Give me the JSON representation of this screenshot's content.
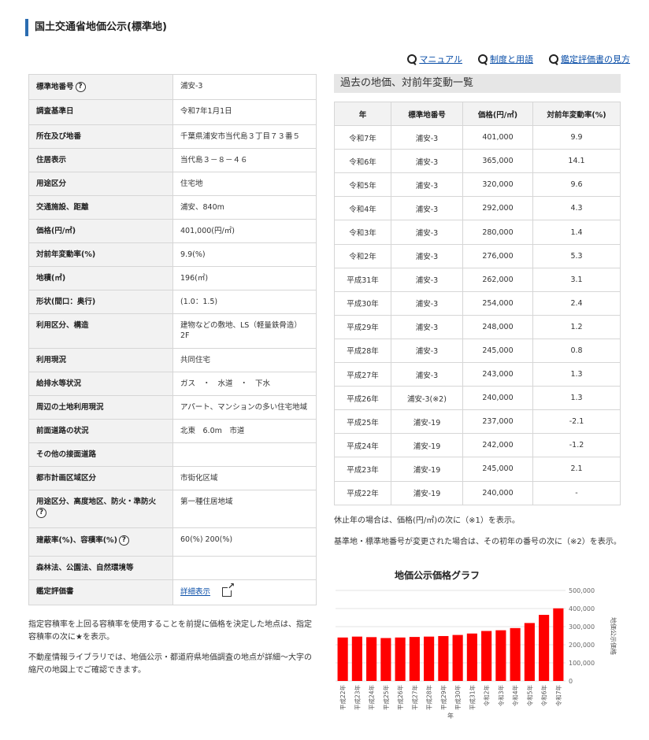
{
  "title": "国土交通省地価公示(標準地)",
  "links": [
    {
      "icon": "search-icon",
      "label": "マニュアル"
    },
    {
      "icon": "search-icon",
      "label": "制度と用語"
    },
    {
      "icon": "search-icon",
      "label": "鑑定評価書の見方"
    }
  ],
  "info": [
    {
      "label": "標準地番号",
      "value": "浦安-3",
      "help": "?"
    },
    {
      "label": "調査基準日",
      "value": "令和7年1月1日"
    },
    {
      "label": "所在及び地番",
      "value": "千葉県浦安市当代島３丁目７３番５"
    },
    {
      "label": "住居表示",
      "value": "当代島３－８－４６"
    },
    {
      "label": "用途区分",
      "value": "住宅地"
    },
    {
      "label": "交通施設、距離",
      "value": "浦安、840m"
    },
    {
      "label": "価格(円/㎡)",
      "value": "401,000(円/㎡)"
    },
    {
      "label": "対前年変動率(%)",
      "value": "9.9(%)"
    },
    {
      "label": "地積(㎡)",
      "value": "196(㎡)"
    },
    {
      "label": "形状(間口：奥行)",
      "value": "(1.0：1.5)"
    },
    {
      "label": "利用区分、構造",
      "value": "建物などの敷地、LS（軽量鉄骨造）",
      "value2": "2F"
    },
    {
      "label": "利用現況",
      "value": "共同住宅"
    },
    {
      "label": "給排水等状況",
      "value": "ガス　・　水道　・　下水"
    },
    {
      "label": "周辺の土地利用現況",
      "value": "アパート、マンションの多い住宅地域"
    },
    {
      "label": "前面道路の状況",
      "value": "北東　6.0m　市道"
    },
    {
      "label": "その他の接面道路",
      "value": ""
    },
    {
      "label": "都市計画区域区分",
      "value": "市街化区域"
    },
    {
      "label": "用途区分、高度地区、防火・準防火",
      "value": "第一種住居地域",
      "help": "?"
    },
    {
      "label": "建蔽率(%)、容積率(%)",
      "value": "60(%) 200(%)",
      "help": "?"
    },
    {
      "label": "森林法、公園法、自然環境等",
      "value": ""
    },
    {
      "label": "鑑定評価書",
      "value": "詳細表示",
      "link": true
    }
  ],
  "notes_left": [
    "指定容積率を上回る容積率を使用することを前提に価格を決定した地点は、指定容積率の次に★を表示。",
    "不動産情報ライブラリでは、地価公示・都道府県地価調査の地点が詳細～大字の縮尺の地図上でご確認できます。"
  ],
  "history": {
    "heading": "過去の地価、対前年変動一覧",
    "columns": [
      "年",
      "標準地番号",
      "価格(円/㎡)",
      "対前年変動率(%)"
    ],
    "rows": [
      [
        "令和7年",
        "浦安-3",
        "401,000",
        "9.9"
      ],
      [
        "令和6年",
        "浦安-3",
        "365,000",
        "14.1"
      ],
      [
        "令和5年",
        "浦安-3",
        "320,000",
        "9.6"
      ],
      [
        "令和4年",
        "浦安-3",
        "292,000",
        "4.3"
      ],
      [
        "令和3年",
        "浦安-3",
        "280,000",
        "1.4"
      ],
      [
        "令和2年",
        "浦安-3",
        "276,000",
        "5.3"
      ],
      [
        "平成31年",
        "浦安-3",
        "262,000",
        "3.1"
      ],
      [
        "平成30年",
        "浦安-3",
        "254,000",
        "2.4"
      ],
      [
        "平成29年",
        "浦安-3",
        "248,000",
        "1.2"
      ],
      [
        "平成28年",
        "浦安-3",
        "245,000",
        "0.8"
      ],
      [
        "平成27年",
        "浦安-3",
        "243,000",
        "1.3"
      ],
      [
        "平成26年",
        "浦安-3(※2)",
        "240,000",
        "1.3"
      ],
      [
        "平成25年",
        "浦安-19",
        "237,000",
        "-2.1"
      ],
      [
        "平成24年",
        "浦安-19",
        "242,000",
        "-1.2"
      ],
      [
        "平成23年",
        "浦安-19",
        "245,000",
        "2.1"
      ],
      [
        "平成22年",
        "浦安-19",
        "240,000",
        "-"
      ]
    ]
  },
  "notes_right": [
    "休止年の場合は、価格(円/㎡)の次に（※1）を表示。",
    "基準地・標準地番号が変更された場合は、その初年の番号の次に（※2）を表示。"
  ],
  "chart_data": {
    "type": "bar",
    "title": "地価公示価格グラフ",
    "xlabel": "年",
    "ylabel": "地価公示価格",
    "categories": [
      "平成22年",
      "平成23年",
      "平成24年",
      "平成25年",
      "平成26年",
      "平成27年",
      "平成28年",
      "平成29年",
      "平成30年",
      "平成31年",
      "令和2年",
      "令和3年",
      "令和4年",
      "令和5年",
      "令和6年",
      "令和7年"
    ],
    "values": [
      240000,
      245000,
      242000,
      237000,
      240000,
      243000,
      245000,
      248000,
      254000,
      262000,
      276000,
      280000,
      292000,
      320000,
      365000,
      401000
    ],
    "yticks": [
      "0",
      "100,000",
      "200,000",
      "300,000",
      "400,000",
      "500,000"
    ],
    "ylim": [
      0,
      500000
    ],
    "grid": true,
    "bar_color": "#ff0000"
  }
}
